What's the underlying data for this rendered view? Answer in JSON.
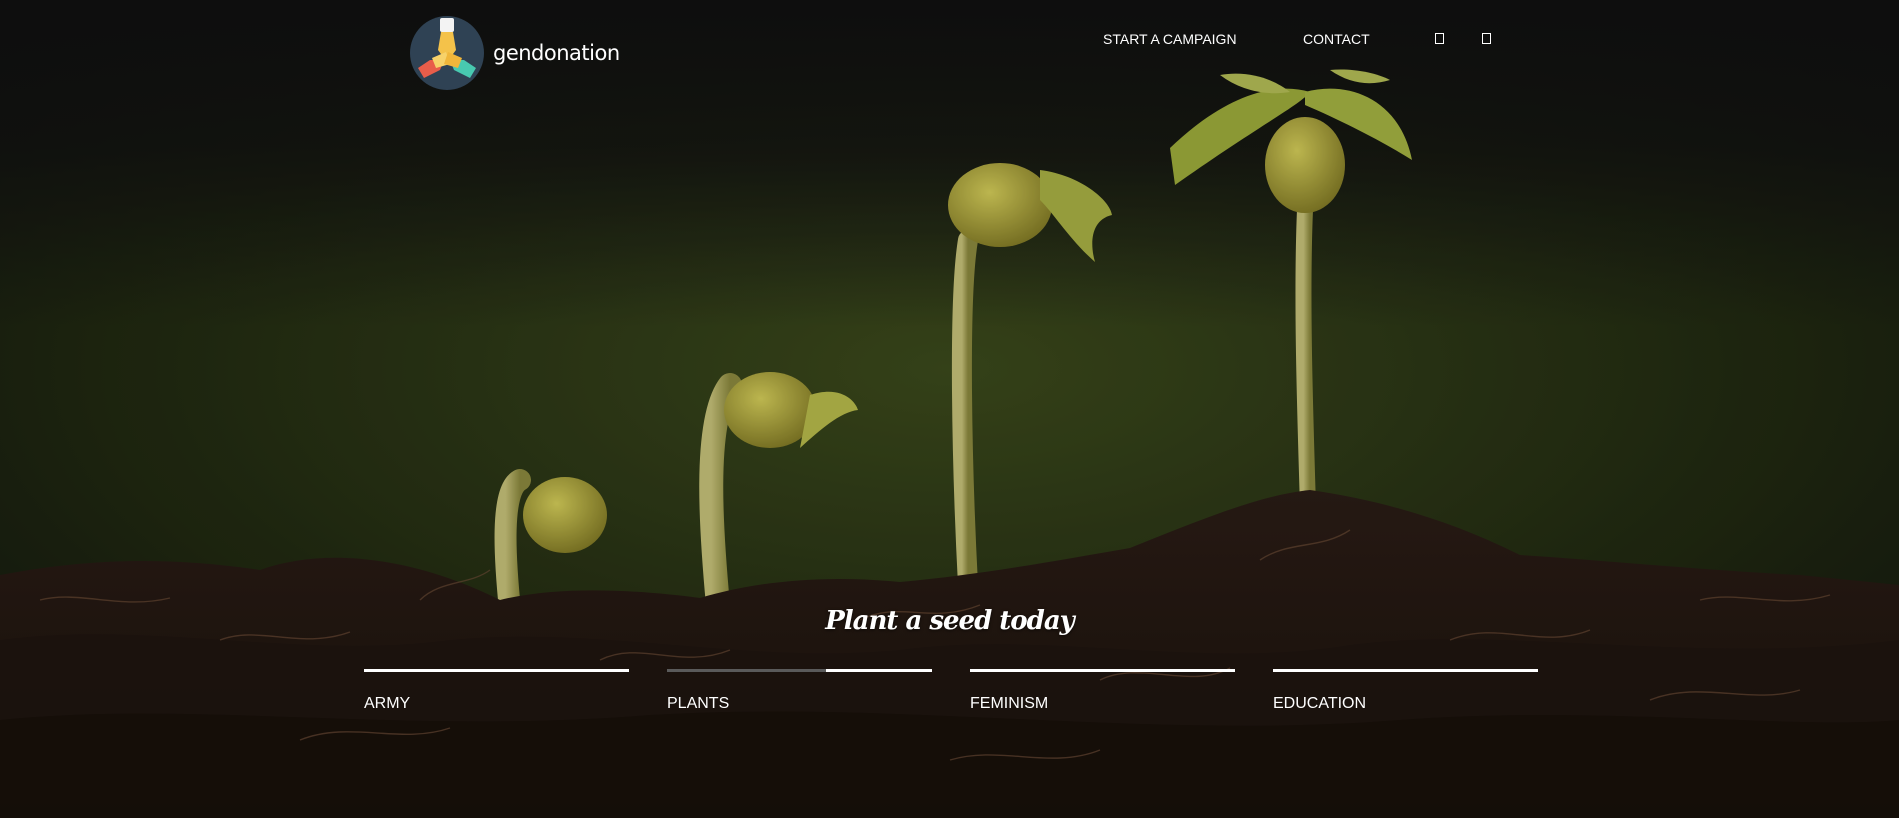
{
  "brand": {
    "name": "gendonation",
    "logo": "hands-circle-logo"
  },
  "nav": {
    "links": [
      "START A CAMPAIGN",
      "CONTACT"
    ],
    "icons": [
      "social-icon",
      "social-icon"
    ]
  },
  "hero": {
    "background": "seedlings-in-soil",
    "tagline": "Plant a seed today"
  },
  "categories": [
    {
      "label": "ARMY",
      "progress": 1.0
    },
    {
      "label": "PLANTS",
      "progress": 0.4
    },
    {
      "label": "FEMINISM",
      "progress": 1.0
    },
    {
      "label": "EDUCATION",
      "progress": 1.0
    }
  ],
  "colors": {
    "soil": "#2a1a12",
    "leaf": "#a9b23e",
    "text": "#ffffff"
  }
}
